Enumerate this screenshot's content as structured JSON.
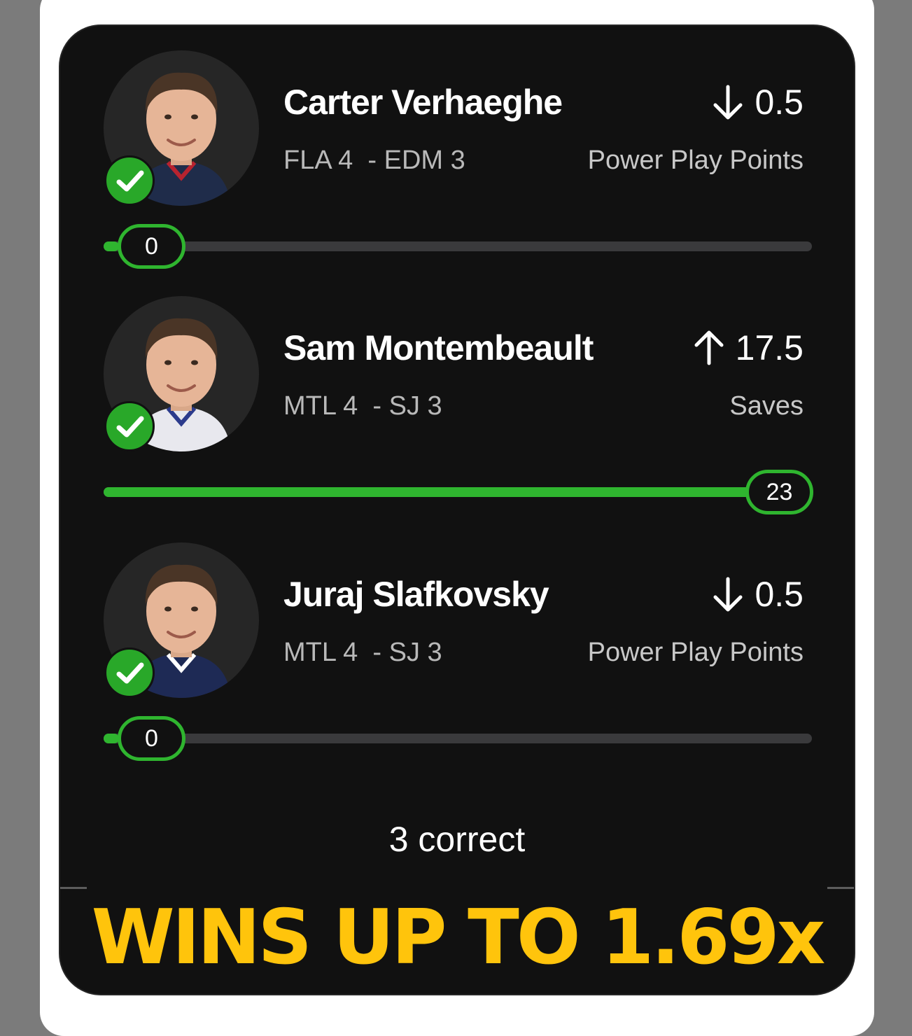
{
  "picks": [
    {
      "name": "Carter Verhaeghe",
      "direction": "down",
      "line": "0.5",
      "matchup": "FLA 4  - EDM 3",
      "stat": "Power Play Points",
      "actual": "0",
      "progress": 0,
      "status": "correct",
      "jersey_color": "#1f2c4a",
      "accent_color": "#b8232f"
    },
    {
      "name": "Sam Montembeault",
      "direction": "up",
      "line": "17.5",
      "matchup": "MTL 4  - SJ 3",
      "stat": "Saves",
      "actual": "23",
      "progress": 1.0,
      "status": "correct",
      "jersey_color": "#e8e8ee",
      "accent_color": "#2c3b8c"
    },
    {
      "name": "Juraj Slafkovsky",
      "direction": "down",
      "line": "0.5",
      "matchup": "MTL 4  - SJ 3",
      "stat": "Power Play Points",
      "actual": "0",
      "progress": 0,
      "status": "correct",
      "jersey_color": "#1e2a55",
      "accent_color": "#ffffff"
    }
  ],
  "summary": "3 correct",
  "headline": "WINS UP TO 1.69x",
  "colors": {
    "card_background": "#111111",
    "progress_green": "#2fb52f",
    "check_green": "#29a829",
    "headline_yellow": "#ffc40c"
  },
  "icons": {
    "check": "check-icon",
    "down": "arrow-down-icon",
    "up": "arrow-up-icon"
  }
}
